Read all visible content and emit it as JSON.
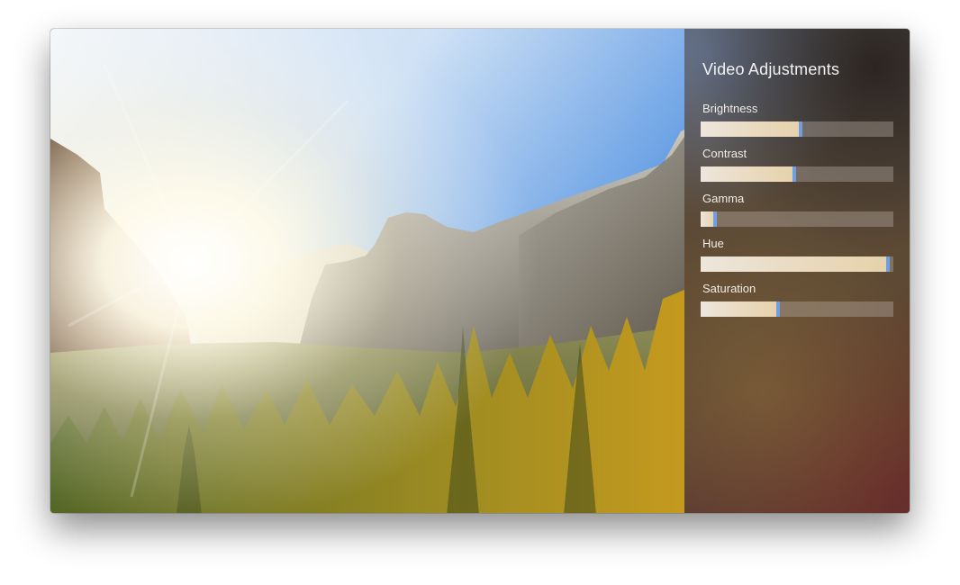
{
  "panel": {
    "title": "Video Adjustments",
    "sliders": [
      {
        "label": "Brightness",
        "value": 0.52
      },
      {
        "label": "Contrast",
        "value": 0.485
      },
      {
        "label": "Gamma",
        "value": 0.075
      },
      {
        "label": "Hue",
        "value": 0.97
      },
      {
        "label": "Saturation",
        "value": 0.4
      }
    ]
  },
  "colors": {
    "slider_thumb": "#6f9fe0",
    "slider_fill": "#e9d9bd",
    "panel_text": "#f2f2f2"
  }
}
